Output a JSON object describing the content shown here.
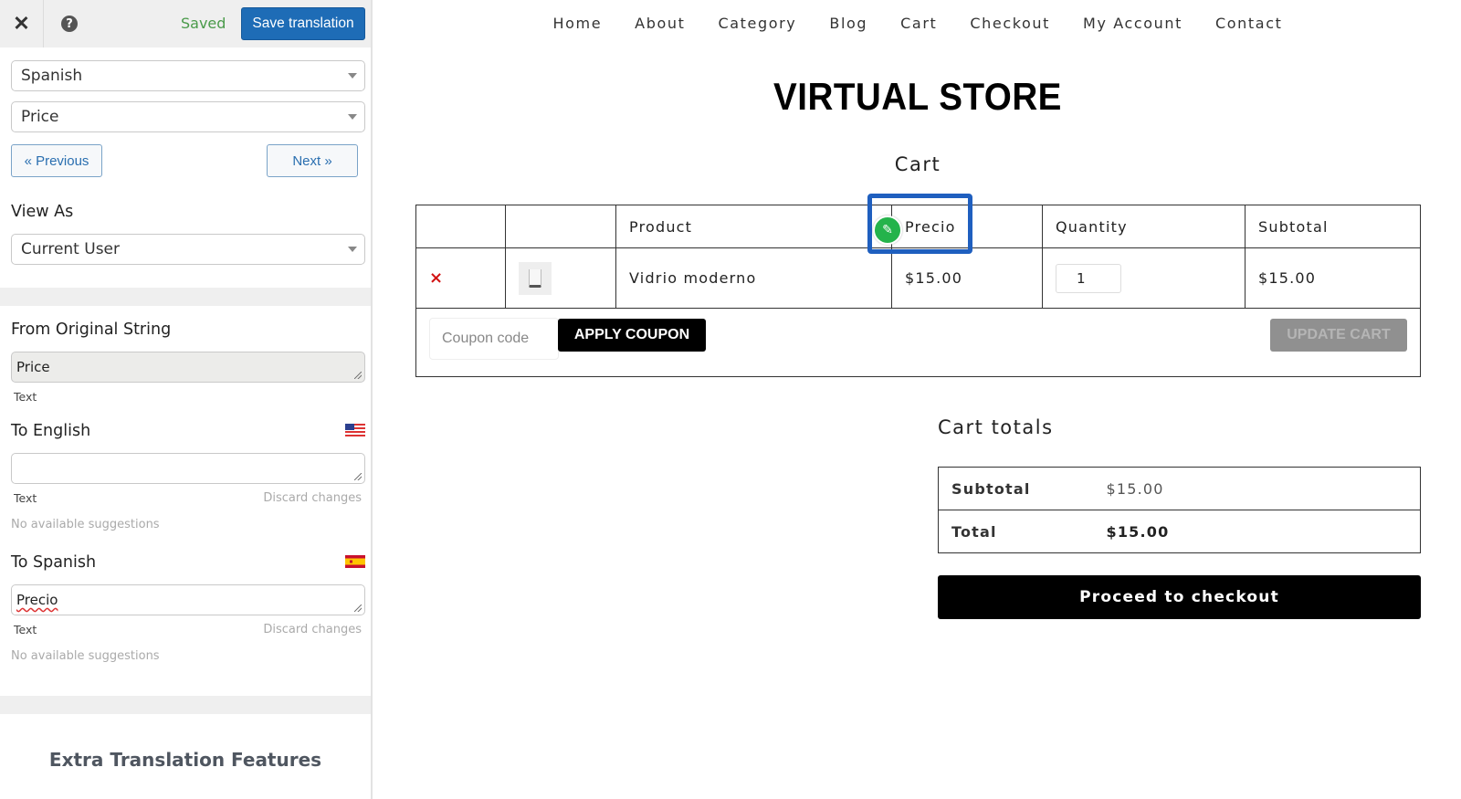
{
  "panel": {
    "close_icon": "close-icon",
    "help_icon": "help-icon",
    "help_glyph": "?",
    "close_glyph": "✕",
    "saved_status": "Saved",
    "save_button": "Save translation",
    "language_select": "Spanish",
    "string_select": "Price",
    "previous_button": "« Previous",
    "next_button": "Next »",
    "view_as_label": "View As",
    "view_as_select": "Current User",
    "original": {
      "label": "From Original String",
      "value": "Price",
      "type": "Text"
    },
    "english": {
      "label": "To English",
      "flag": "us-flag-icon",
      "value": "",
      "type": "Text",
      "discard": "Discard changes",
      "suggestions": "No available suggestions"
    },
    "spanish": {
      "label": "To Spanish",
      "flag": "es-flag-icon",
      "value": "Precio",
      "type": "Text",
      "discard": "Discard changes",
      "suggestions": "No available suggestions"
    },
    "extra_title": "Extra Translation Features"
  },
  "site": {
    "menu": [
      "Home",
      "About",
      "Category",
      "Blog",
      "Cart",
      "Checkout",
      "My Account",
      "Contact"
    ],
    "store_title": "VIRTUAL STORE",
    "page_title": "Cart",
    "cart_table": {
      "headers": [
        "",
        "",
        "Product",
        "Precio",
        "Quantity",
        "Subtotal"
      ],
      "rows": [
        {
          "remove": "×",
          "product": "Vidrio moderno",
          "price": "$15.00",
          "quantity": "1",
          "subtotal": "$15.00"
        }
      ]
    },
    "coupon_placeholder": "Coupon code",
    "apply_coupon": "APPLY COUPON",
    "update_cart": "UPDATE CART",
    "totals_title": "Cart totals",
    "totals": [
      {
        "label": "Subtotal",
        "value": "$15.00"
      },
      {
        "label": "Total",
        "value": "$15.00"
      }
    ],
    "checkout_button": "Proceed to checkout",
    "pencil_glyph": "✎"
  },
  "colors": {
    "save_button": "#1e6cb6",
    "saved_text": "#4a9a4a",
    "highlight": "#1f5fbf",
    "edit_badge": "#24b34b",
    "remove": "#d21414"
  }
}
